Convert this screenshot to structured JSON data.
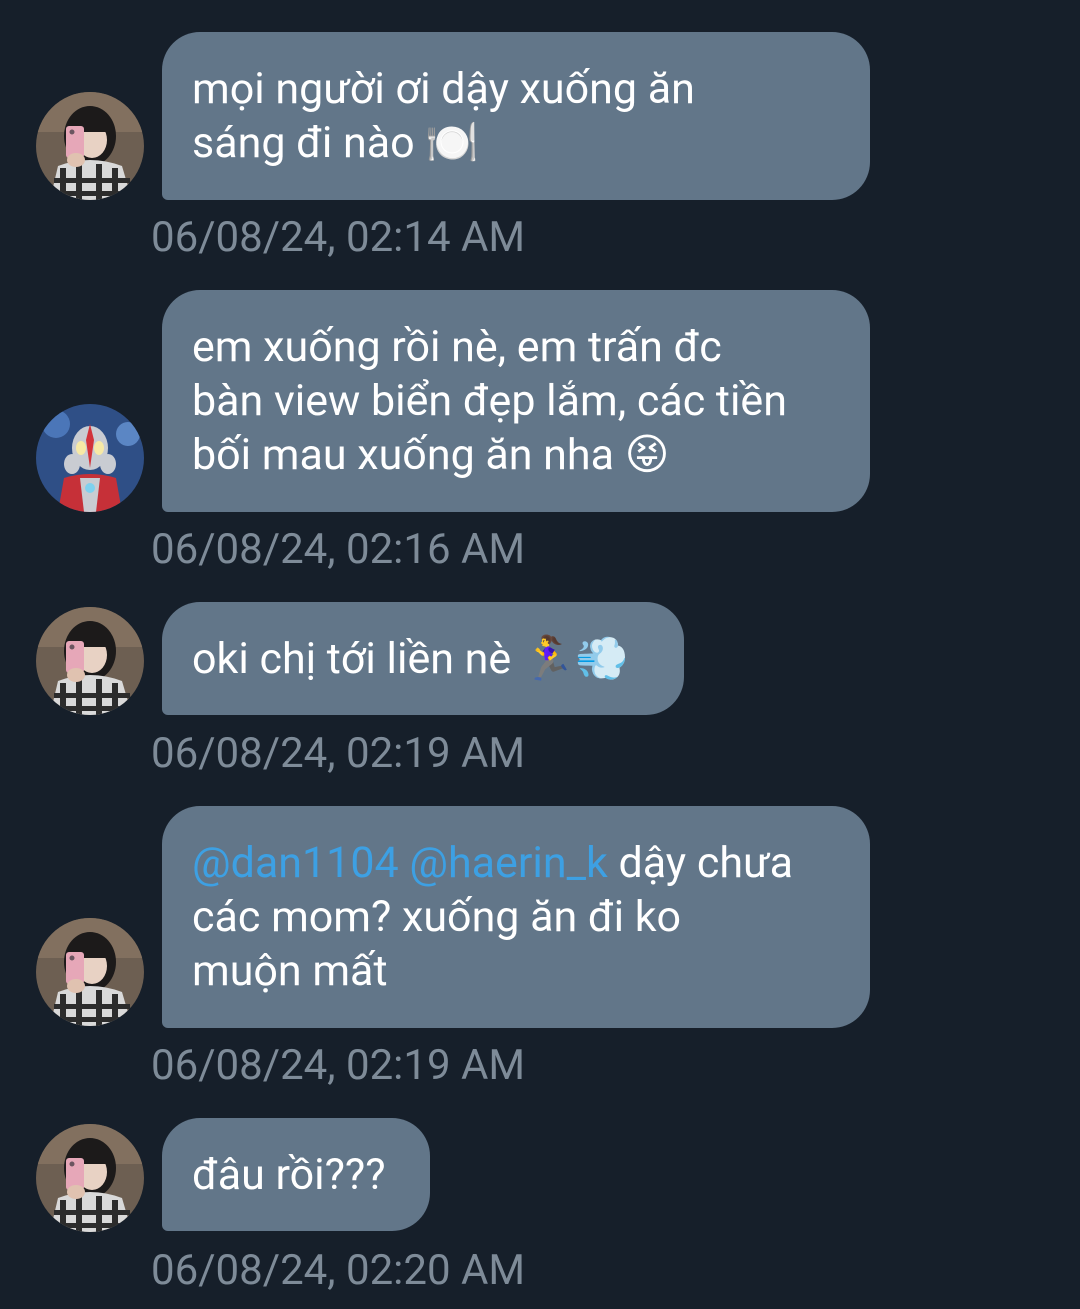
{
  "colors": {
    "background": "#161f2a",
    "bubble": "#627689",
    "text": "#ffffff",
    "mention": "#3da0e3",
    "timestamp": "#7e8b98"
  },
  "messages": [
    {
      "avatar": "girl-phone-avatar",
      "lines": [
        "mọi người ơi dậy xuống ăn",
        "sáng đi nào 🍽️"
      ],
      "timestamp": "06/08/24, 02:14 AM"
    },
    {
      "avatar": "ultraman-avatar",
      "lines": [
        "em xuống rồi nè, em trấn đc",
        "bàn view biển đẹp lắm, các tiền",
        "bối mau xuống ăn nha 😝"
      ],
      "timestamp": "06/08/24, 02:16 AM"
    },
    {
      "avatar": "girl-phone-avatar",
      "lines": [
        "oki chị tới liền nè 🏃‍♀️💨"
      ],
      "timestamp": "06/08/24, 02:19 AM"
    },
    {
      "avatar": "girl-phone-avatar",
      "mention_1": "@dan1104",
      "mention_2": "@haerin_k",
      "line1_rest": " dậy chưa",
      "lines": [
        "các mom? xuống ăn đi ko",
        "muộn mất"
      ],
      "timestamp": "06/08/24, 02:19 AM"
    },
    {
      "avatar": "girl-phone-avatar",
      "lines": [
        "đâu rồi???"
      ],
      "timestamp": "06/08/24, 02:20 AM"
    }
  ]
}
